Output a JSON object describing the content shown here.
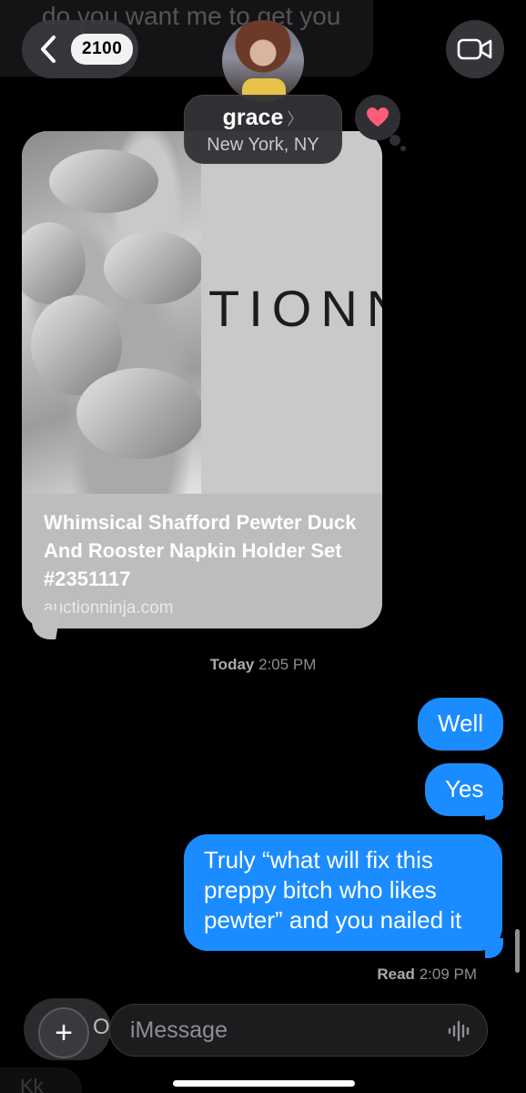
{
  "background_faded_message": "do you want me to get you",
  "header": {
    "back_count": "2100",
    "contact_name": "grace",
    "contact_location": "New York, NY"
  },
  "link_preview": {
    "image_logo_text": "TIONN",
    "title": "Whimsical Shafford Pewter Duck And Rooster Napkin Holder Set #2351117",
    "domain": "auctionninja.com",
    "reaction": "heart"
  },
  "timestamp": {
    "day": "Today",
    "time": "2:05 PM"
  },
  "messages": [
    {
      "text": "Well"
    },
    {
      "text": "Yes"
    },
    {
      "text": "Truly “what will fix this preppy bitch who likes pewter” and you nailed it"
    }
  ],
  "read_receipt": {
    "label": "Read",
    "time": "2:09 PM"
  },
  "composer": {
    "placeholder": "iMessage",
    "faded_behind_plus": "O"
  },
  "bottom_faded_message": "Kk",
  "colors": {
    "outgoing_bubble": "#1a8cff",
    "background": "#000000",
    "reaction_heart": "#ff5c7a"
  },
  "icons": [
    "chevron-left-icon",
    "video-camera-icon",
    "heart-icon",
    "plus-icon",
    "waveform-icon"
  ]
}
